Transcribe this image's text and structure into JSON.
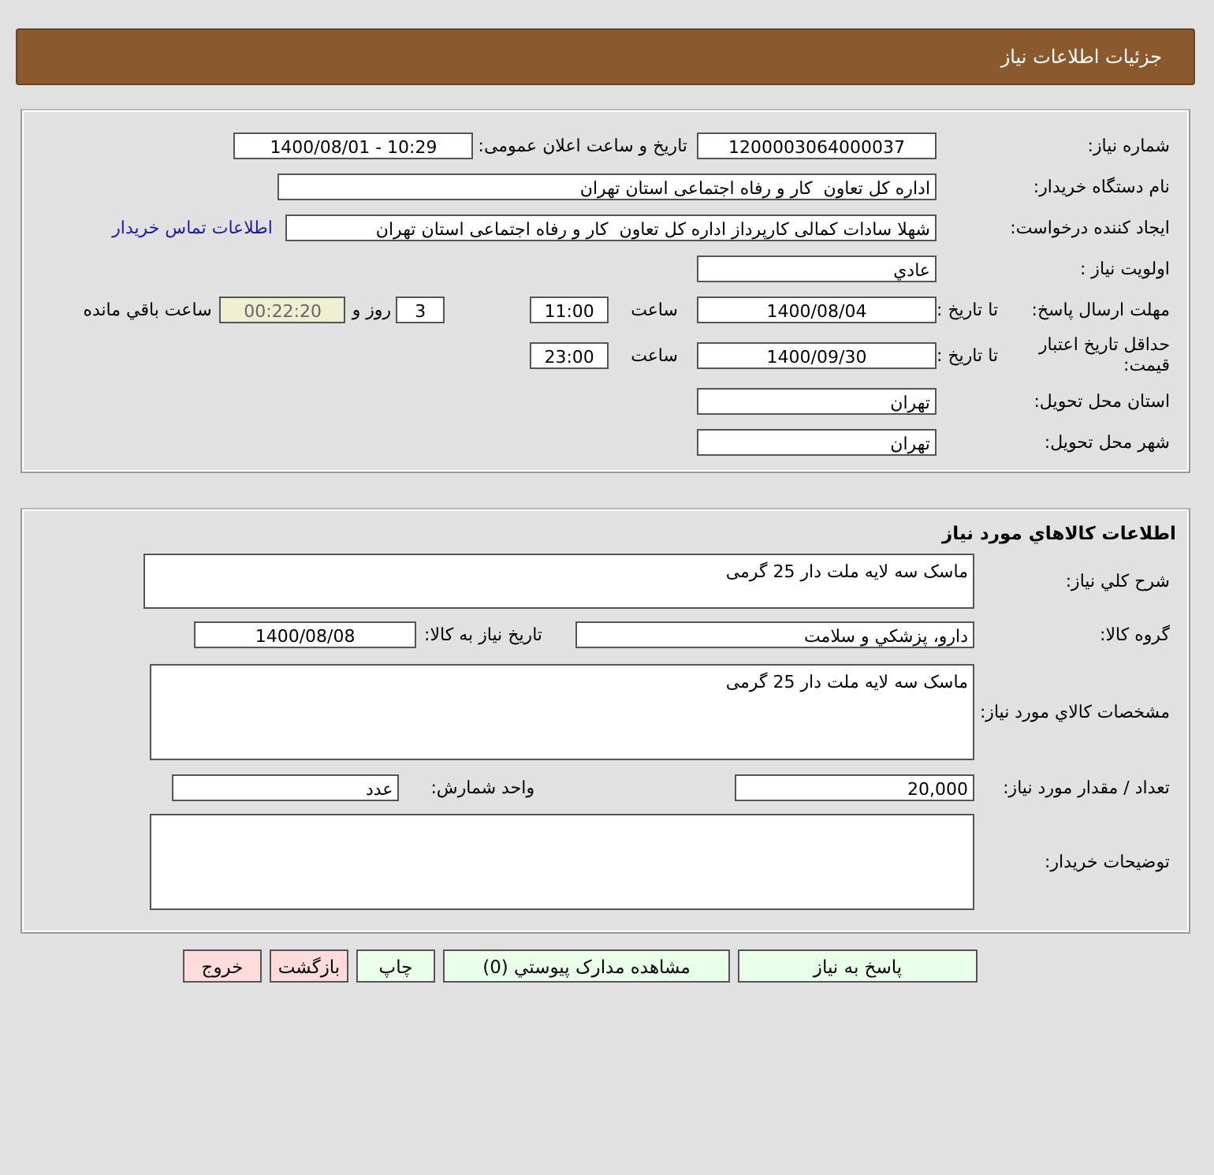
{
  "header": {
    "title": "جزئیات اطلاعات نیاز"
  },
  "need_info": {
    "need_number": {
      "label": "شماره نیاز:",
      "value": "1200003064000037"
    },
    "announce": {
      "label": "تاریخ و ساعت اعلان عمومی:",
      "value": "1400/08/01 - 10:29"
    },
    "buyer": {
      "label": "نام دستگاه خریدار:",
      "value": "اداره کل تعاون  کار و رفاه اجتماعی استان تهران"
    },
    "requester": {
      "label": "ایجاد کننده درخواست:",
      "value": "شهلا سادات کمالی کارپرداز اداره کل تعاون  کار و رفاه اجتماعی استان تهران",
      "link": "اطلاعات تماس خریدار"
    },
    "priority": {
      "label": "اولویت نیاز :",
      "value": "عادي"
    },
    "reply_deadline": {
      "label": "مهلت ارسال پاسخ:",
      "sublabel": "تا تاریخ :",
      "date": "1400/08/04",
      "time_label": "ساعت",
      "time": "11:00",
      "days": "3",
      "days_label": "روز و",
      "remaining": "00:22:20",
      "remaining_label": "ساعت باقي مانده"
    },
    "price_validity": {
      "label": "حداقل تاریخ اعتبار قیمت:",
      "sublabel": "تا تاریخ :",
      "date": "1400/09/30",
      "time_label": "ساعت",
      "time": "23:00"
    },
    "province": {
      "label": "استان محل تحویل:",
      "value": "تهران"
    },
    "city": {
      "label": "شهر محل تحویل:",
      "value": "تهران"
    }
  },
  "goods": {
    "title": "اطلاعات کالاهاي مورد نیاز",
    "summary": {
      "label": "شرح کلي نیاز:",
      "value": "ماسک سه لایه ملت دار 25 گرمی"
    },
    "group": {
      "label": "گروه کالا:",
      "value": "دارو، پزشکي و سلامت",
      "date_label": "تاریخ نیاز به کالا:",
      "date": "1400/08/08"
    },
    "specs": {
      "label": "مشخصات کالاي مورد نیاز:",
      "value": "ماسک سه لایه ملت دار 25 گرمی"
    },
    "quantity": {
      "label": "تعداد / مقدار مورد نیاز:",
      "value": "20,000",
      "unit_label": "واحد شمارش:",
      "unit": "عدد"
    },
    "notes": {
      "label": "توضیحات خریدار:"
    }
  },
  "buttons": [
    {
      "label": "پاسخ به نیاز",
      "kind": "primary"
    },
    {
      "label": "مشاهده مدارک پیوستي (0)",
      "kind": "primary"
    },
    {
      "label": "چاپ",
      "kind": "primary"
    },
    {
      "label": "بازگشت",
      "kind": "danger"
    },
    {
      "label": "خروج",
      "kind": "danger"
    }
  ]
}
